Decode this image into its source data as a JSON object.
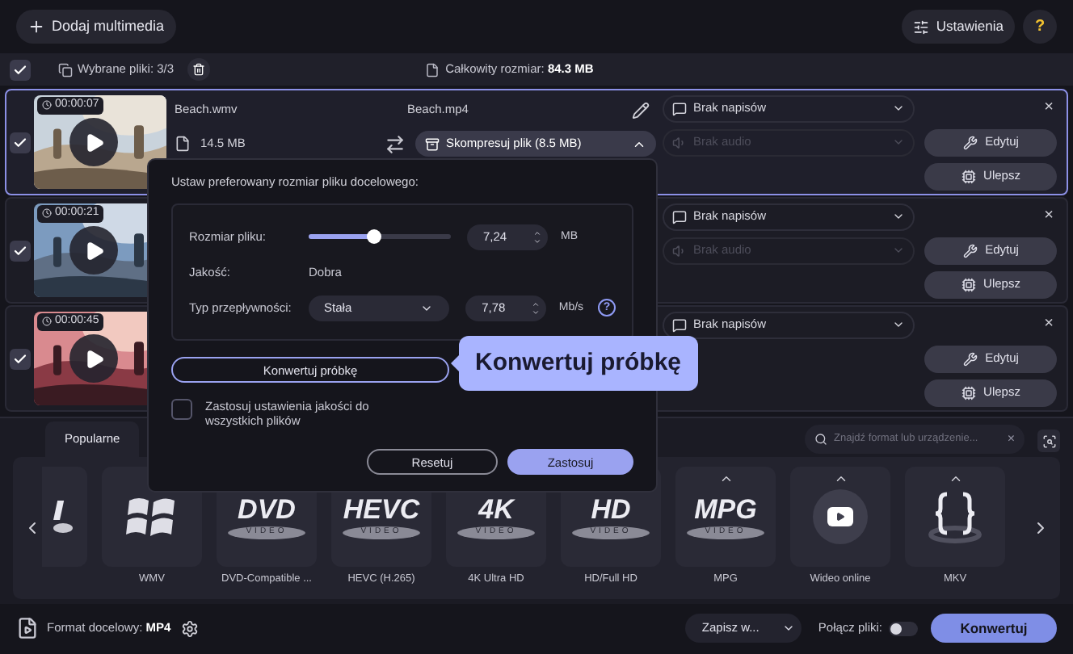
{
  "toolbar": {
    "add_button": "Dodaj multimedia",
    "settings_button": "Ustawienia",
    "help_button": "?"
  },
  "selection_bar": {
    "checked": true,
    "selected_label": "Wybrane pliki:",
    "selected_count": "3/3",
    "total_label": "Całkowity rozmiar:",
    "total_value": "84.3 MB"
  },
  "files": [
    {
      "selected": true,
      "checked": true,
      "duration": "00:00:07",
      "source_name": "Beach.wmv",
      "source_size": "14.5 MB",
      "output_name": "Beach.mp4",
      "compress": "Skompresuj plik (8.5 MB)",
      "subtitles": "Brak napisów",
      "audio": "Brak audio",
      "edit": "Edytuj",
      "enhance": "Ulepsz",
      "close": "×"
    },
    {
      "selected": false,
      "checked": true,
      "duration": "00:00:21",
      "subtitles": "Brak napisów",
      "audio": "Brak audio",
      "edit": "Edytuj",
      "enhance": "Ulepsz",
      "close": "×"
    },
    {
      "selected": false,
      "checked": true,
      "duration": "00:00:45",
      "subtitles": "Brak napisów",
      "edit": "Edytuj",
      "enhance": "Ulepsz",
      "close": "×"
    }
  ],
  "compress_popup": {
    "title": "Ustaw preferowany rozmiar pliku docelowego:",
    "size_label": "Rozmiar pliku:",
    "size_slider": {
      "level": 0.46
    },
    "size_value": "7,24",
    "size_unit": "MB",
    "quality_label": "Jakość:",
    "quality_value": "Dobra",
    "bitrate_label": "Typ przepływności:",
    "bitrate_type": "Stała",
    "bitrate_value": "7,78",
    "bitrate_unit": "Mb/s",
    "help": "?",
    "sample_button": "Konwertuj próbkę",
    "apply_all": {
      "label": "Zastosuj ustawienia jakości do wszystkich plików",
      "checked": false
    },
    "reset_button": "Resetuj",
    "apply_button": "Zastosuj"
  },
  "callout": "Konwertuj próbkę",
  "formats": {
    "tabs": [
      {
        "label": "Popularne",
        "selected": true
      }
    ],
    "search_placeholder": "Znajdź format lub urządzenie...",
    "close": "×",
    "items": [
      {
        "kind": "partial",
        "expandable": false
      },
      {
        "kind": "windows",
        "label": "WMV"
      },
      {
        "kind": "disc",
        "logo": "DVD",
        "logo_sub": "VIDEO",
        "label": "DVD-Compatible ..."
      },
      {
        "kind": "disc",
        "logo": "HEVC",
        "logo_sub": "VIDEO",
        "label": "HEVC (H.265)"
      },
      {
        "kind": "disc",
        "logo": "4K",
        "logo_sub": "VIDEO",
        "label": "4K Ultra HD"
      },
      {
        "kind": "disc",
        "logo": "HD",
        "logo_sub": "VIDEO",
        "label": "HD/Full HD"
      },
      {
        "kind": "disc",
        "logo": "MPG",
        "logo_sub": "VIDEO",
        "label": "MPG",
        "expandable": true
      },
      {
        "kind": "online",
        "label": "Wideo online",
        "expandable": true
      },
      {
        "kind": "braces",
        "label": "MKV",
        "expandable": true
      }
    ]
  },
  "bottom_bar": {
    "format_label": "Format docelowy:",
    "format_value": "MP4",
    "save_to": "Zapisz w...",
    "merge_label": "Połącz pliki:",
    "merge_on": false,
    "convert_button": "Konwertuj"
  }
}
